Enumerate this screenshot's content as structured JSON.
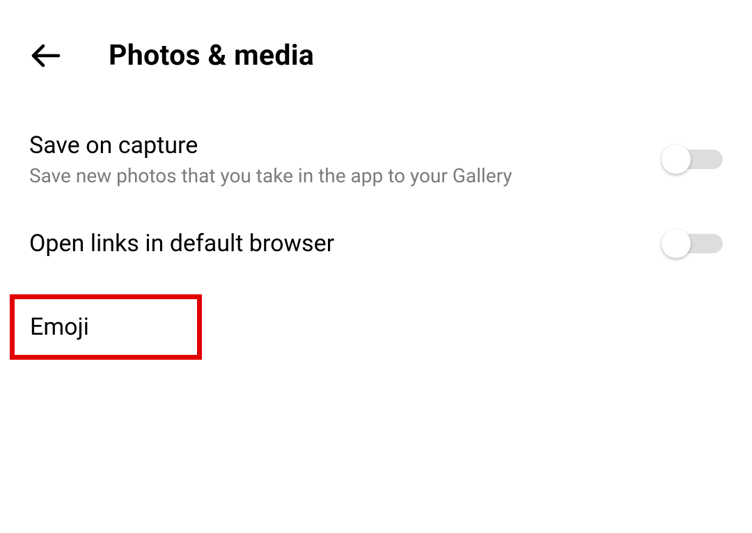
{
  "header": {
    "title": "Photos & media"
  },
  "settings": {
    "saveOnCapture": {
      "title": "Save on capture",
      "subtitle": "Save new photos that you take in the app to your Gallery",
      "enabled": false
    },
    "openLinks": {
      "title": "Open links in default browser",
      "enabled": false
    },
    "emoji": {
      "title": "Emoji"
    }
  }
}
